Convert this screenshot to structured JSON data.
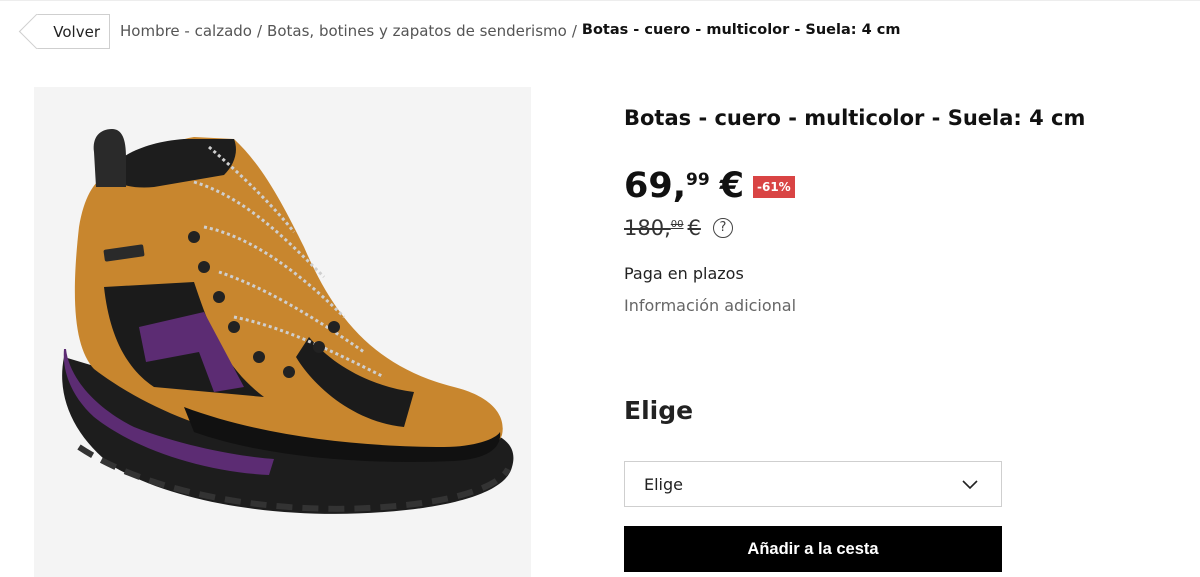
{
  "breadcrumb": {
    "back_label": "Volver",
    "items": [
      "Hombre - calzado",
      "Botas, botines y zapatos de senderismo"
    ],
    "separator": "/",
    "current": "Botas - cuero - multicolor - Suela: 4 cm"
  },
  "product": {
    "title": "Botas - cuero - multicolor - Suela: 4 cm",
    "price": {
      "integer": "69,",
      "cents": "99",
      "currency": "€"
    },
    "discount": "-61%",
    "old_price": {
      "integer": "180,",
      "cents": "00",
      "currency": "€"
    },
    "help_icon_glyph": "?",
    "installments": "Paga en plazos",
    "extra_info": "Información adicional",
    "image": {
      "subject": "hiking-boot",
      "colors": {
        "leather": "#c8862e",
        "accent": "#5c2c73",
        "sole": "#1d1d1d"
      }
    }
  },
  "options": {
    "heading": "Elige",
    "select_value": "Elige",
    "add_to_cart": "Añadir a la cesta"
  },
  "colors": {
    "discount_badge": "#d94444",
    "cart_button": "#000000"
  }
}
